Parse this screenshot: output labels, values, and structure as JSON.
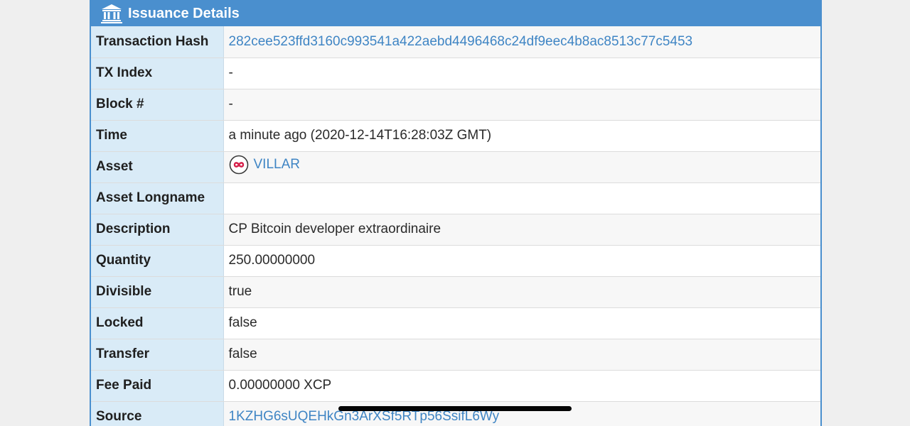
{
  "header": {
    "icon": "bank-icon",
    "title": "Issuance Details",
    "color": "#4a8fce"
  },
  "rows": [
    {
      "label": "Transaction Hash",
      "value": "282cee523ffd3160c993541a422aebd4496468c24df9eec4b8ac8513c77c5453"
    },
    {
      "label": "TX Index",
      "value": "-"
    },
    {
      "label": "Block #",
      "value": "-"
    },
    {
      "label": "Time",
      "value": "a minute ago (2020-12-14T16:28:03Z GMT)"
    },
    {
      "label": "Asset",
      "value": "VILLAR",
      "icon": "asset-infinity-icon"
    },
    {
      "label": "Asset Longname",
      "value": ""
    },
    {
      "label": "Description",
      "value": "CP Bitcoin developer extraordinaire"
    },
    {
      "label": "Quantity",
      "value": "250.00000000"
    },
    {
      "label": "Divisible",
      "value": "true"
    },
    {
      "label": "Locked",
      "value": "false"
    },
    {
      "label": "Transfer",
      "value": "false"
    },
    {
      "label": "Fee Paid",
      "value": "0.00000000 XCP"
    },
    {
      "label": "Source",
      "value": "1KZHG6sUQEHkGn3ArXSf5RTp56SsifL6Wy"
    }
  ],
  "colors": {
    "label_bg": "#d9ebf7",
    "link": "#3f85c4"
  }
}
